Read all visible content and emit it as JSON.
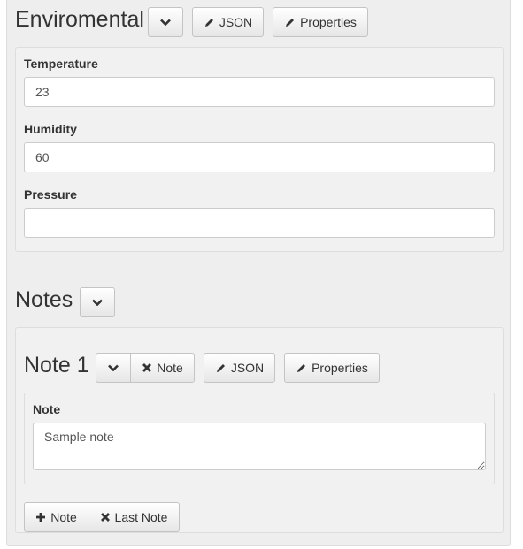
{
  "environmental": {
    "title": "Enviromental",
    "json_label": "JSON",
    "properties_label": "Properties",
    "fields": [
      {
        "label": "Temperature",
        "value": "23"
      },
      {
        "label": "Humidity",
        "value": "60"
      },
      {
        "label": "Pressure",
        "value": ""
      }
    ]
  },
  "notes": {
    "title": "Notes",
    "item": {
      "title": "Note 1",
      "delete_label": "Note",
      "json_label": "JSON",
      "properties_label": "Properties",
      "field_label": "Note",
      "field_value": "Sample note"
    },
    "add_label": "Note",
    "remove_last_label": "Last Note"
  }
}
